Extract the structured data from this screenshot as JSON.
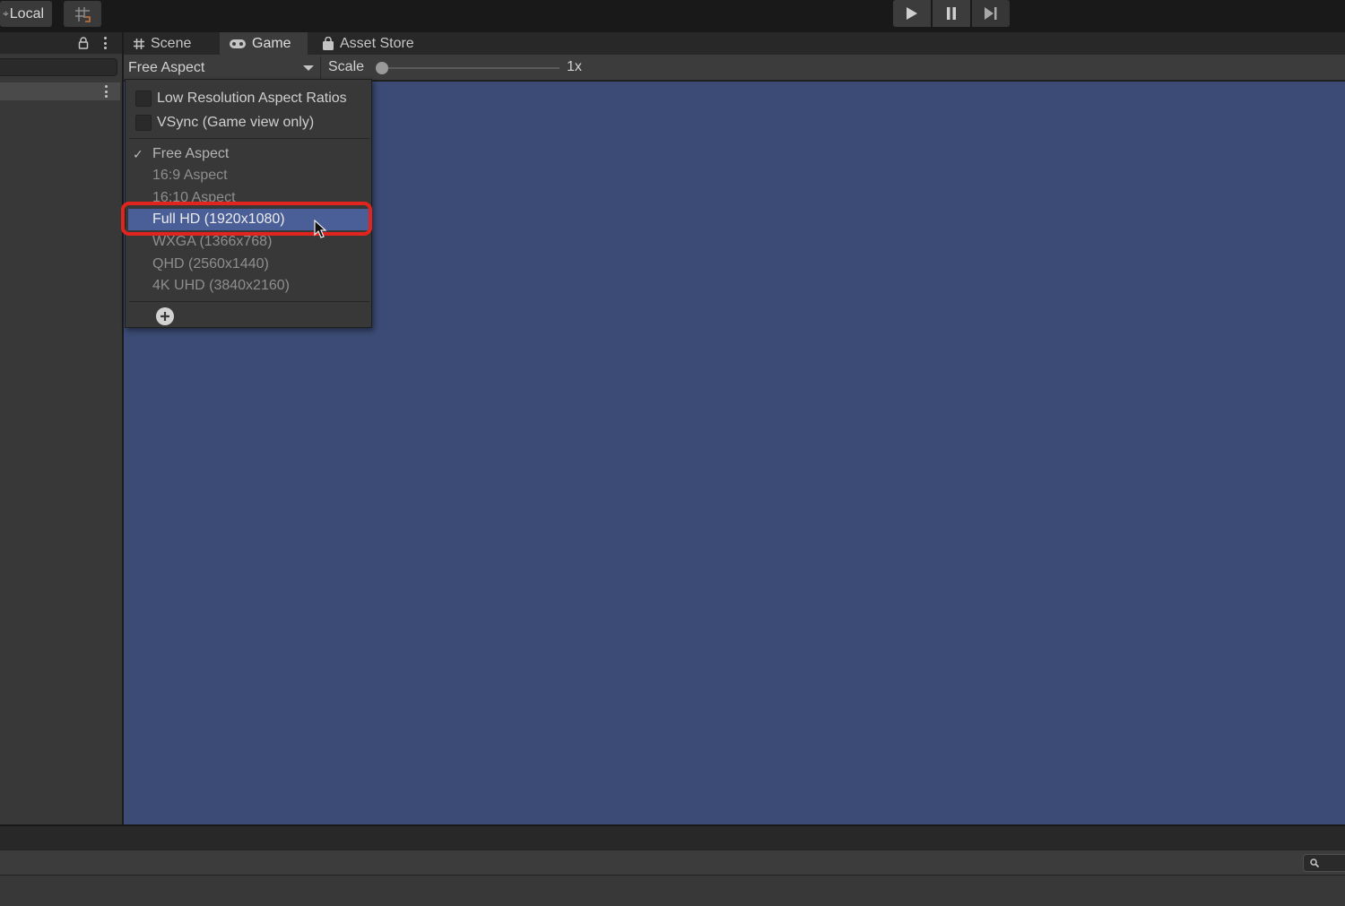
{
  "toolbar": {
    "pivot_label": "Local",
    "play_icon": "play-icon",
    "pause_icon": "pause-icon",
    "step_icon": "step-icon"
  },
  "tabs": [
    {
      "label": "Scene",
      "icon": "hash-grid-icon",
      "active": false
    },
    {
      "label": "Game",
      "icon": "gamepad-icon",
      "active": true
    },
    {
      "label": "Asset Store",
      "icon": "shopping-bag-icon",
      "active": false
    }
  ],
  "game_toolbar": {
    "aspect_selected": "Free Aspect",
    "scale_label": "Scale",
    "scale_value": "1x",
    "scale_fraction": 0.0
  },
  "popup": {
    "checkboxes": [
      {
        "label": "Low Resolution Aspect Ratios",
        "checked": false
      },
      {
        "label": "VSync (Game view only)",
        "checked": false
      }
    ],
    "options": [
      {
        "label": "Free Aspect",
        "checked": true
      },
      {
        "label": "16:9 Aspect",
        "checked": false
      },
      {
        "label": "16:10 Aspect",
        "checked": false
      },
      {
        "label": "Full HD (1920x1080)",
        "checked": false,
        "highlighted": true
      },
      {
        "label": "WXGA (1366x768)",
        "checked": false
      },
      {
        "label": "QHD (2560x1440)",
        "checked": false
      },
      {
        "label": "4K UHD (3840x2160)",
        "checked": false
      }
    ],
    "check_mark": "✓",
    "add_icon": "plus-circle-icon"
  },
  "colors": {
    "game_view_background": "#3b4b75",
    "highlight": "#4a5e98",
    "annotation_ring": "#e0251f"
  }
}
